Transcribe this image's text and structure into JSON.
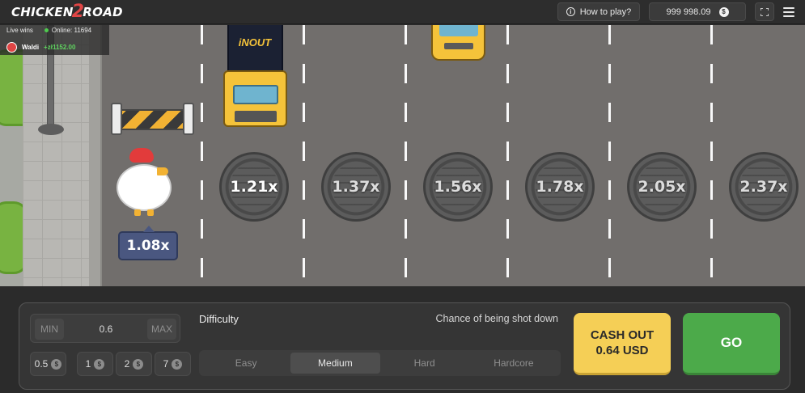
{
  "header": {
    "logo_part1": "CHICKEN",
    "logo_number": "2",
    "logo_part2": "ROAD",
    "how_to_play": "How to play?",
    "balance": "999 998.09",
    "currency_symbol": "$",
    "info_icon": "info-icon",
    "fullscreen_icon": "fullscreen-icon",
    "menu_icon": "hamburger-menu-icon"
  },
  "live_wins": {
    "title": "Live wins",
    "online_label": "Online: 11694",
    "user": "Waldi",
    "amount": "+zł1152.00"
  },
  "game": {
    "truck_brand": "iNOUT",
    "current_multiplier": "1.08x",
    "multipliers": [
      "1.21x",
      "1.37x",
      "1.56x",
      "1.78x",
      "2.05x",
      "2.37x"
    ],
    "colors": {
      "road": "#716e6c",
      "accent_yellow": "#f5c33a",
      "marker_blue": "#4a5780"
    }
  },
  "controls": {
    "min_label": "MIN",
    "bet_value": "0.6",
    "max_label": "MAX",
    "quick_bets": [
      "0.5",
      "1",
      "2",
      "7"
    ],
    "coin_symbol": "$",
    "difficulty_label": "Difficulty",
    "chance_label": "Chance of being shot down",
    "difficulties": [
      "Easy",
      "Medium",
      "Hard",
      "Hardcore"
    ],
    "selected_difficulty": "Medium",
    "cashout_label": "CASH OUT",
    "cashout_amount": "0.64 USD",
    "go_label": "GO",
    "colors": {
      "cashout": "#f5cf56",
      "go": "#4caa4a"
    }
  }
}
